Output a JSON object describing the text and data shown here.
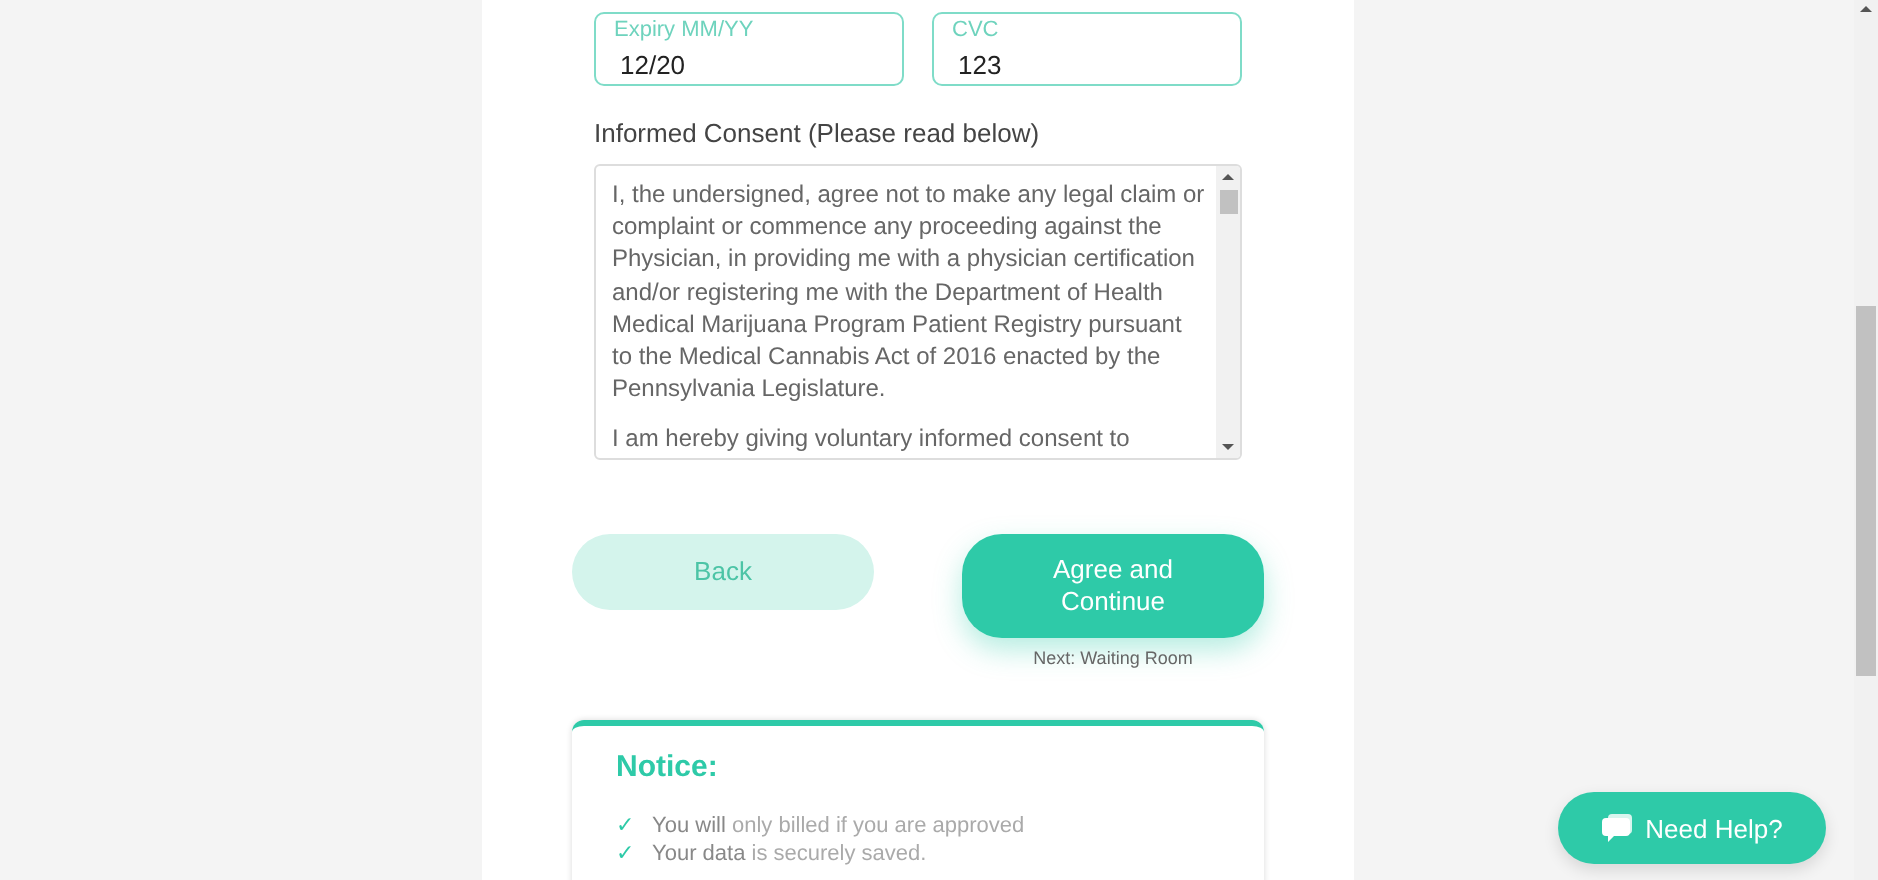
{
  "payment_fields": [
    {
      "label": "Expiry MM/YY",
      "value": "12/20"
    },
    {
      "label": "CVC",
      "value": "123"
    }
  ],
  "consent": {
    "label": "Informed Consent (Please read below)",
    "paragraphs": [
      "I, the undersigned, agree not to make any legal claim or complaint or commence any proceeding against the Physician, in providing me with a physician certification and/or registering me with the Department of Health Medical Marijuana Program Patient Registry pursuant to the Medical Cannabis Act of 2016 enacted by the Pennsylvania Legislature.",
      "I am hereby giving voluntary informed consent to"
    ]
  },
  "buttons": [
    {
      "kind": "secondary",
      "label": "Back"
    },
    {
      "kind": "primary",
      "label": "Agree and Continue",
      "note": "Next: Waiting Room"
    }
  ],
  "notice": {
    "title": "Notice:",
    "items": [
      {
        "mark": "✓",
        "text": "**You will** only billed if you are approved"
      },
      {
        "mark": "✓",
        "text": "**Your data** is securely saved."
      }
    ]
  },
  "help_button": {
    "label": "Need Help?"
  }
}
